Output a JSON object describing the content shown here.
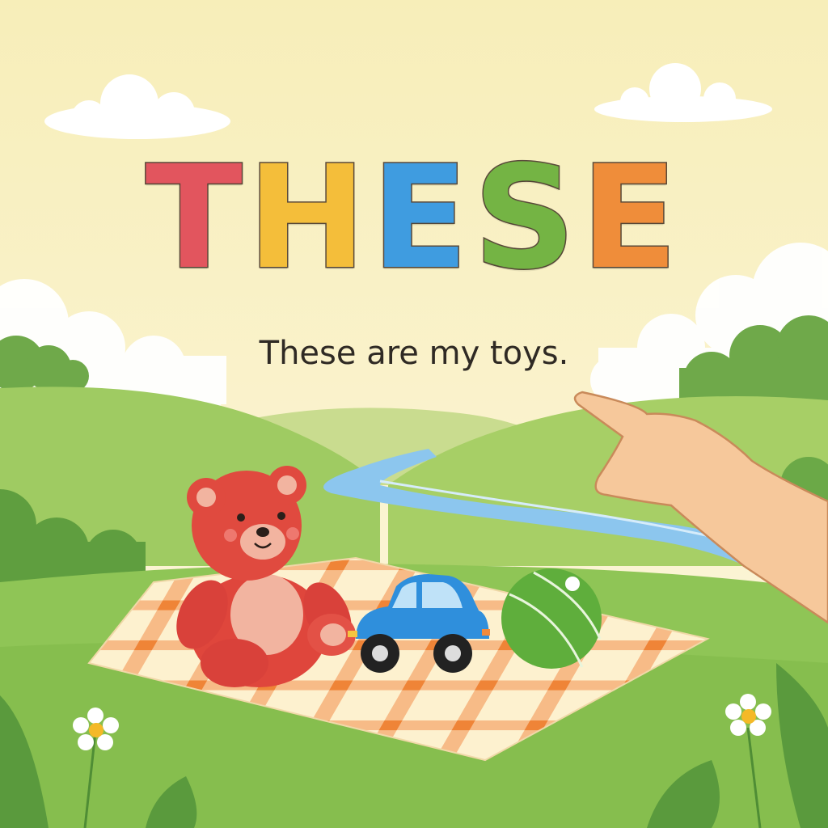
{
  "title": {
    "letters": [
      {
        "char": "T",
        "color": "#e2555e"
      },
      {
        "char": "H",
        "color": "#f4be3a"
      },
      {
        "char": "E",
        "color": "#3f9ce0"
      },
      {
        "char": "S",
        "color": "#74b444"
      },
      {
        "char": "E",
        "color": "#ef8d3a"
      }
    ]
  },
  "subtitle": "These are my toys.",
  "colors": {
    "sky": "#fbf3cf",
    "grass": "#8fc556",
    "river": "#8cc6ee",
    "blanket_stripe": "#f08a3c",
    "bear": "#e2473d",
    "car": "#2f8fdc",
    "ball": "#5fae3c"
  },
  "icons": [
    "cloud-icon",
    "teddy-bear-icon",
    "toy-car-icon",
    "ball-icon",
    "pointing-hand-icon",
    "daisy-icon"
  ]
}
